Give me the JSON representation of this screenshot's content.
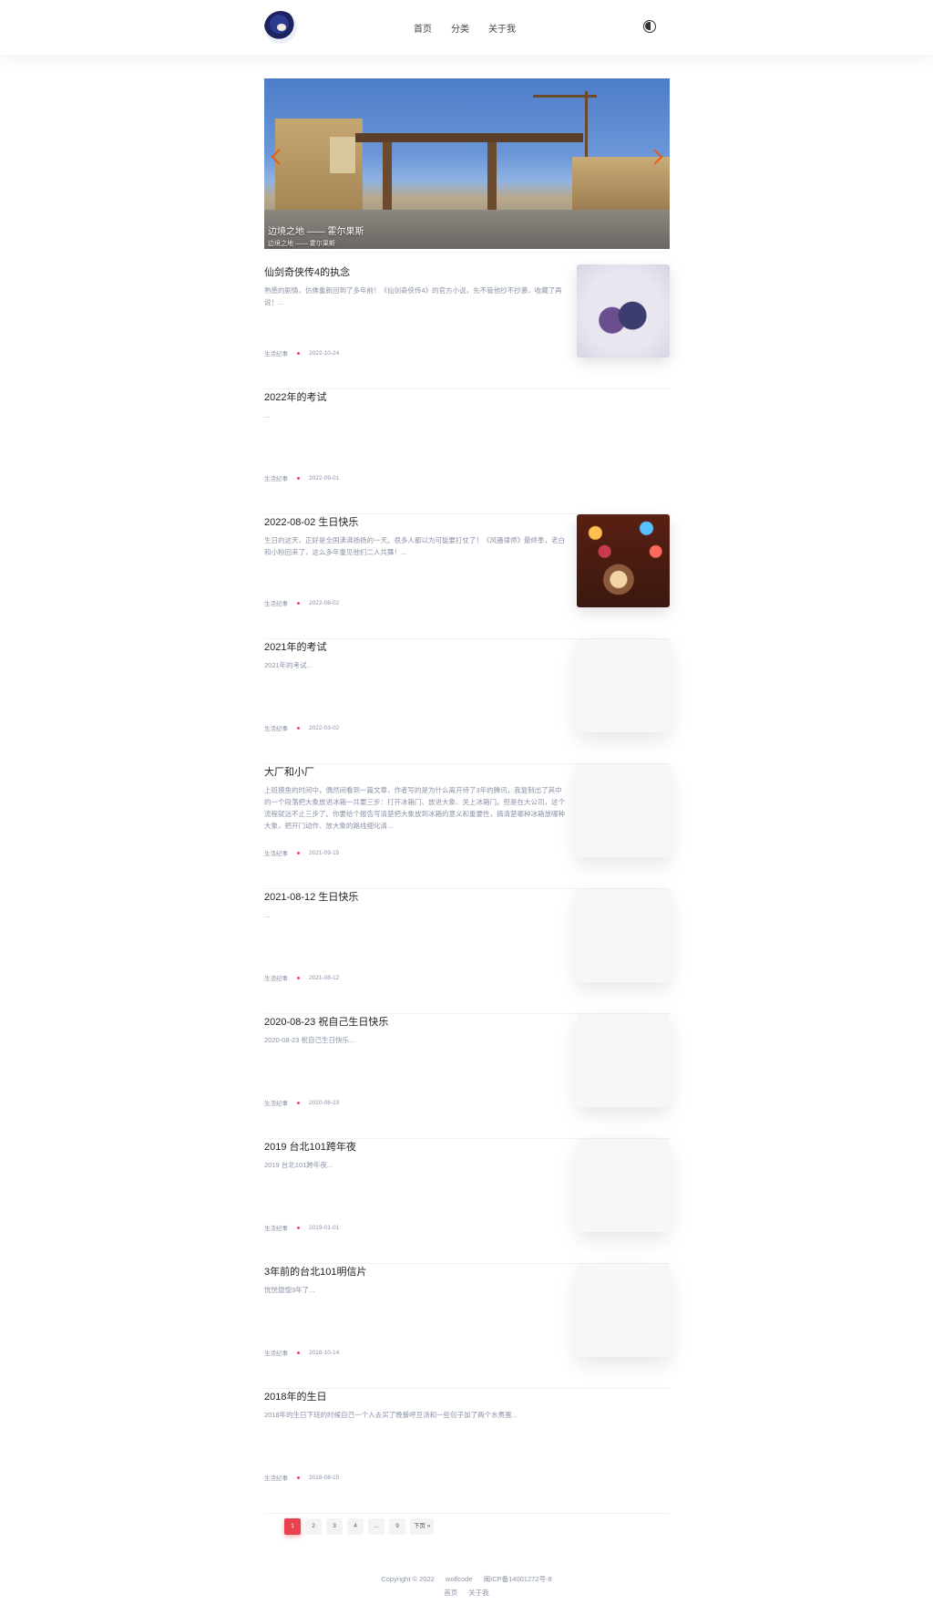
{
  "header": {
    "nav": [
      "首页",
      "分类",
      "关于我"
    ]
  },
  "banner": {
    "caption": "边境之地 —— 霍尔果斯",
    "sub_caption": "边境之地 —— 霍尔果斯"
  },
  "posts": [
    {
      "title": "仙剑奇侠传4的执念",
      "excerpt": "熟悉的剧情，仿佛重新回到了多年前！《仙剑奇侠传4》的官方小说，先不管他抄不抄袭，收藏了再说！...",
      "category": "生活纪事",
      "date": "2022-10-24",
      "thumb": "anime"
    },
    {
      "title": "2022年的考试",
      "excerpt": "...",
      "category": "生活纪事",
      "date": "2022-09-01",
      "thumb": "none"
    },
    {
      "title": "2022-08-02 生日快乐",
      "excerpt": "生日的这天，正好是全国沸沸扬扬的一天。很多人都以为可能要打仗了！《风骚律师》最终季，老白和小粉回来了，这么多年重见他们二人共舞！...",
      "category": "生活纪事",
      "date": "2022-08-02",
      "thumb": "cake"
    },
    {
      "title": "2021年的考试",
      "excerpt": "2021年的考试...",
      "category": "生活纪事",
      "date": "2022-03-02",
      "thumb": "blank"
    },
    {
      "title": "大厂和小厂",
      "excerpt": "上班摸鱼的时间中，偶然间看到一篇文章，作者写的是为什么离开待了3年的腾讯，我复制出了其中的一个段落把大象放进冰箱一共要三步：打开冰箱门、放进大象、关上冰箱门。但是在大公司，这个流程就远不止三步了。你要给个报告写清楚把大象放到冰箱的意义和重要性，搞清楚哪种冰箱放哪种大象，把开门动作、放大象的路线细化清...",
      "category": "生活纪事",
      "date": "2021-09-15",
      "thumb": "blank"
    },
    {
      "title": "2021-08-12 生日快乐",
      "excerpt": "...",
      "category": "生活纪事",
      "date": "2021-08-12",
      "thumb": "blank"
    },
    {
      "title": "2020-08-23 祝自己生日快乐",
      "excerpt": "2020-08-23 祝自己生日快乐...",
      "category": "生活纪事",
      "date": "2020-08-23",
      "thumb": "blank"
    },
    {
      "title": "2019 台北101跨年夜",
      "excerpt": "2019 台北101跨年夜...",
      "category": "生活纪事",
      "date": "2019-01-01",
      "thumb": "blank"
    },
    {
      "title": "3年前的台北101明信片",
      "excerpt": "恍恍惚惚3年了...",
      "category": "生活纪事",
      "date": "2018-10-14",
      "thumb": "blank"
    },
    {
      "title": "2018年的生日",
      "excerpt": "2018年的生日下班的时候自己一个人去买了晚餐呼豆汤和一些包子加了两个水煮蛋...",
      "category": "生活纪事",
      "date": "2018-08-15",
      "thumb": "none"
    }
  ],
  "pagination": {
    "pages": [
      "1",
      "2",
      "3",
      "4",
      "...",
      "9",
      "下页 »"
    ],
    "current": "1"
  },
  "footer": {
    "copyright": "Copyright © 2022",
    "author": "wolfcode",
    "icp": "闽ICP备14001272号-8",
    "links": [
      "首页",
      "关于我"
    ]
  },
  "colors": {
    "accent": "#e8424e",
    "meta_text": "#8a93a8"
  }
}
